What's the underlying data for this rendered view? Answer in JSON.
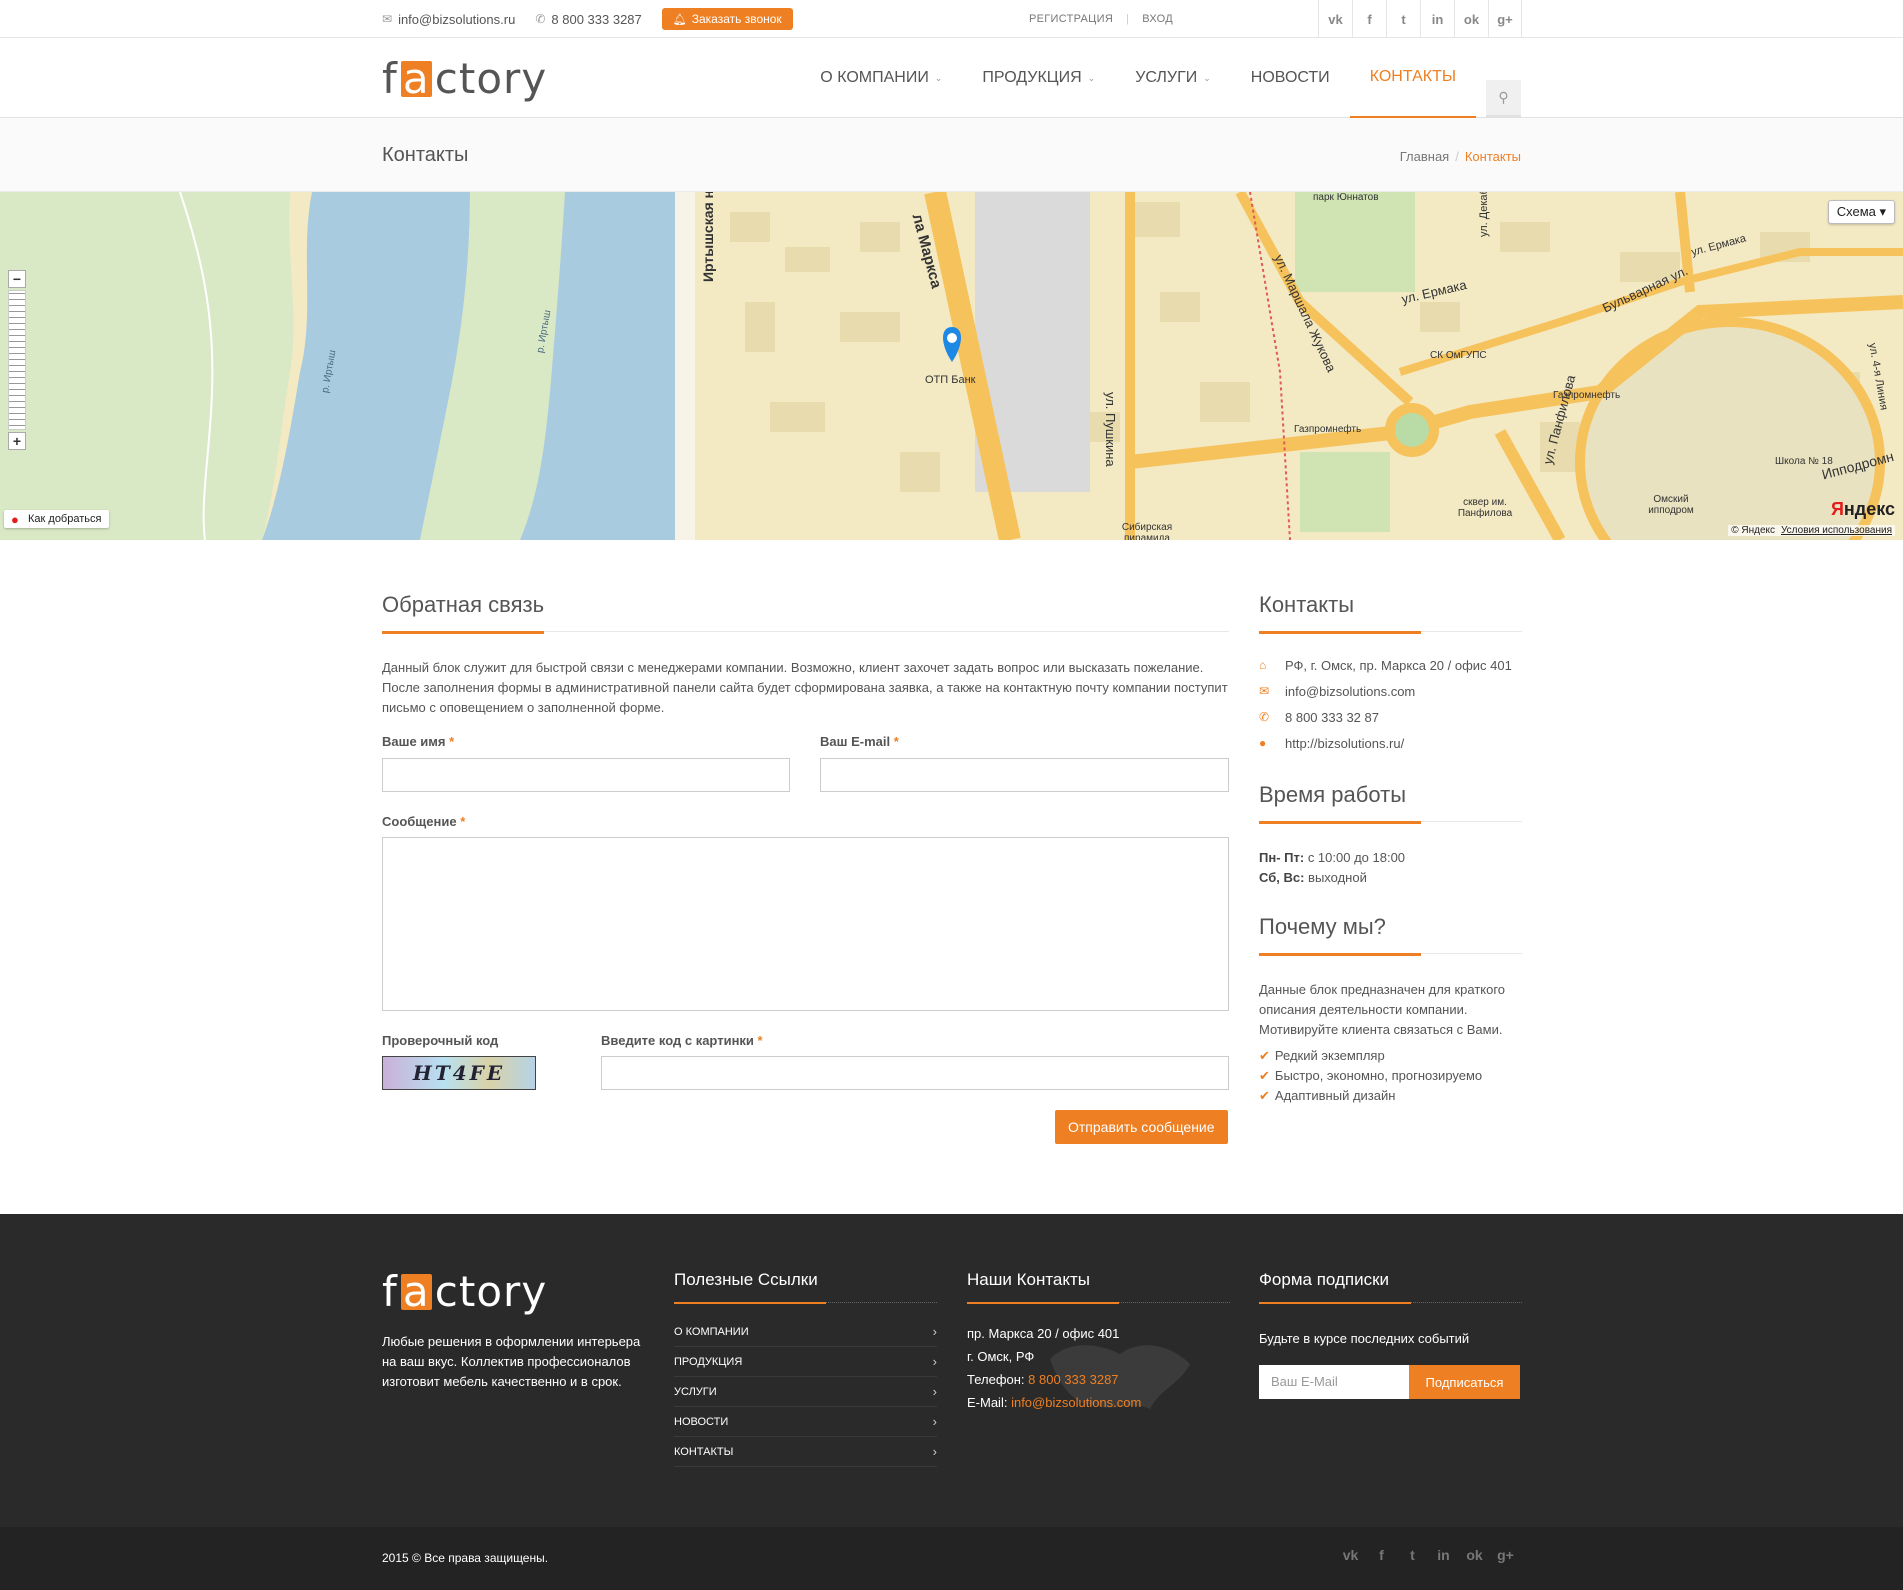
{
  "topbar": {
    "email": "info@bizsolutions.ru",
    "phone": "8 800 333 3287",
    "callback_label": "Заказать звонок",
    "register": "РЕГИСТРАЦИЯ",
    "login": "ВХОД",
    "social": [
      {
        "icon": "vk-icon",
        "glyph": "vk"
      },
      {
        "icon": "facebook-icon",
        "glyph": "f"
      },
      {
        "icon": "twitter-icon",
        "glyph": "t"
      },
      {
        "icon": "linkedin-icon",
        "glyph": "in"
      },
      {
        "icon": "odnoklassniki-icon",
        "glyph": "ok"
      },
      {
        "icon": "google-plus-icon",
        "glyph": "g+"
      }
    ]
  },
  "logo": {
    "pre": "f",
    "box": "a",
    "post": "ctory"
  },
  "nav": {
    "items": [
      {
        "label": "О компании",
        "caret": true
      },
      {
        "label": "Продукция",
        "caret": true
      },
      {
        "label": "Услуги",
        "caret": true
      },
      {
        "label": "Новости",
        "caret": false
      },
      {
        "label": "Контакты",
        "caret": false,
        "active": true
      }
    ]
  },
  "titlebar": {
    "title": "Контакты",
    "crumb_home": "Главная",
    "crumb_current": "Контакты"
  },
  "map": {
    "mode_label": "Схема ▾",
    "route_label": "Как добраться",
    "brand": "ндекс",
    "brand_y": "Я",
    "copyright": "© Яндекс",
    "terms": "Условия использования",
    "labels": [
      {
        "text": "Иртышская наб.",
        "kind": "street-big"
      },
      {
        "text": "ла Маркса",
        "kind": "street-big"
      },
      {
        "text": "ул. Маршала Жукова",
        "kind": "street"
      },
      {
        "text": "ул. Ермака",
        "kind": "street"
      },
      {
        "text": "Бульварная ул.",
        "kind": "street"
      },
      {
        "text": "ул. Пушкина",
        "kind": "street"
      },
      {
        "text": "ул. Декабристов",
        "kind": "street"
      },
      {
        "text": "ул. Панфилова",
        "kind": "street"
      },
      {
        "text": "ул. Ермака",
        "kind": "street"
      },
      {
        "text": "Ипподромн",
        "kind": "street"
      },
      {
        "text": "ул. 4-я Линия",
        "kind": "street"
      },
      {
        "text": "ОТП Банк",
        "kind": "poi"
      },
      {
        "text": "Газпромнефть",
        "kind": "poi"
      },
      {
        "text": "Газпромнефть",
        "kind": "poi"
      },
      {
        "text": "СК ОмГУПС",
        "kind": "poi"
      },
      {
        "text": "парк Юннатов",
        "kind": "poi"
      },
      {
        "text": "сквер им. Панфилова",
        "kind": "poi"
      },
      {
        "text": "Омский ипподром",
        "kind": "poi"
      },
      {
        "text": "Школа № 18",
        "kind": "poi"
      },
      {
        "text": "Сибирская пирамида",
        "kind": "poi"
      },
      {
        "text": "р. Иртыш",
        "kind": "river"
      },
      {
        "text": "р. Иртыш",
        "kind": "river"
      }
    ]
  },
  "feedback": {
    "title": "Обратная связь",
    "intro": "Данный блок служит для быстрой связи с менеджерами компании. Возможно, клиент захочет задать вопрос или высказать пожелание. После заполнения формы в административной панели сайта будет сформирована заявка, а также на контактную почту компании поступит письмо с оповещением о заполненной форме.",
    "name_label": "Ваше имя",
    "email_label": "Ваш E-mail",
    "message_label": "Сообщение",
    "captcha_label": "Проверочный код",
    "captcha_input_label": "Введите код с картинки",
    "captcha_text": "HT4FE",
    "required_mark": "*",
    "submit_label": "Отправить сообщение"
  },
  "sidebar": {
    "contacts_title": "Контакты",
    "contacts": [
      {
        "icon": "home-icon",
        "glyph": "⌂",
        "text": "РФ, г. Омск, пр. Маркса 20 / офис 401"
      },
      {
        "icon": "envelope-icon",
        "glyph": "✉",
        "text": "info@bizsolutions.com"
      },
      {
        "icon": "phone-icon",
        "glyph": "✆",
        "text": "8 800 333 32 87"
      },
      {
        "icon": "globe-icon",
        "glyph": "●",
        "text": "http://bizsolutions.ru/"
      }
    ],
    "hours_title": "Время работы",
    "weekdays_label": "Пн- Пт:",
    "weekdays_value": "с 10:00 до 18:00",
    "weekend_label": "Сб, Вс:",
    "weekend_value": "выходной",
    "why_title": "Почему мы?",
    "why_text": "Данные блок предназначен для краткого описания деятельности компании. Мотивируйте клиента связаться с Вами.",
    "why_points": [
      "Редкий экземпляр",
      "Быстро, экономно, прогнозируемо",
      "Адаптивный дизайн"
    ]
  },
  "footer": {
    "about": "Любые решения в оформлении интерьера на ваш вкус. Коллектив профессионалов изготовит мебель качественно и в срок.",
    "links_title": "Полезные Ссылки",
    "links": [
      "О компании",
      "Продукция",
      "Услуги",
      "Новости",
      "Контакты"
    ],
    "contacts_title": "Наши Контакты",
    "address1": "пр. Маркса 20 / офис 401",
    "address2": "г. Омск, РФ",
    "phone_label": "Телефон:",
    "phone": "8 800 333 3287",
    "email_label": "E-Mail:",
    "email": "info@bizsolutions.com",
    "subscribe_title": "Форма подписки",
    "subscribe_text": "Будьте в курсе последних событий",
    "subscribe_placeholder": "Ваш E-Mail",
    "subscribe_button": "Подписаться",
    "copyright": "2015 © Все права защищены."
  },
  "colors": {
    "accent": "#ee7f22",
    "footer_bg": "#2a2a2a",
    "copy_bg": "#232323",
    "map_water": "#a9cbe0",
    "map_green": "#d9e8c5",
    "map_land": "#f3e9c3",
    "map_road": "#f6c25b"
  }
}
